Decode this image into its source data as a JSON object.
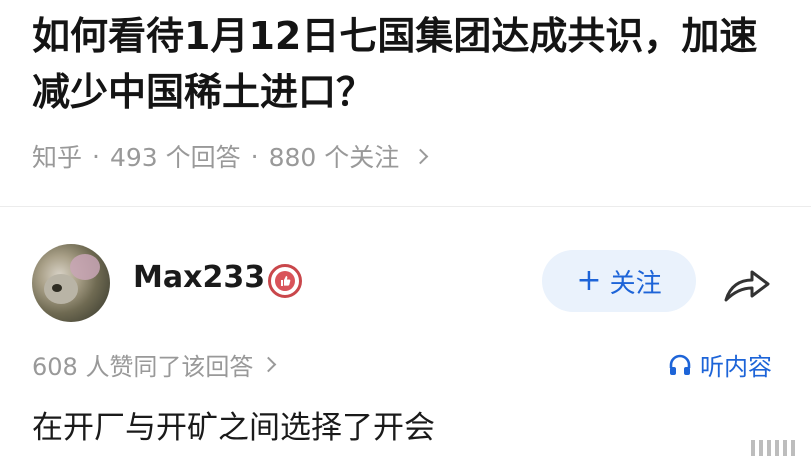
{
  "question": {
    "title": "如何看待1月12日七国集团达成共识，加速减少中国稀土进口？",
    "source": "知乎",
    "answers": "493 个回答",
    "followers": "880 个关注",
    "separator": "·"
  },
  "answer": {
    "author_name": "Max233",
    "follow_label": "关注",
    "follow_plus": "+",
    "agree_text": "608 人赞同了该回答",
    "listen_label": "听内容",
    "content": "在开厂与开矿之间选择了开会"
  },
  "icons": {
    "chevron": "chevron-right-icon",
    "share": "share-arrow-icon",
    "headphones": "headphones-icon",
    "badge": "thumbs-up-badge-icon"
  },
  "colors": {
    "accent": "#1d64d8",
    "follow_bg": "#eaf2fc",
    "meta_gray": "#999999",
    "badge_red": "#d9545a"
  }
}
